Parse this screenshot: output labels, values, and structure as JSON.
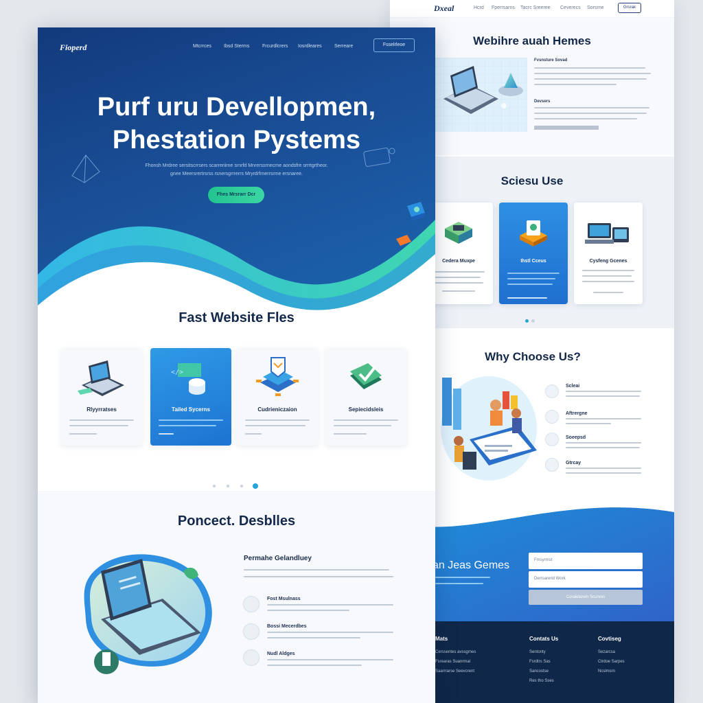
{
  "back": {
    "nav": {
      "logo": "Dxeal",
      "links": [
        "Hcrd",
        "Fperrsarns",
        "Tacrc Sreeree",
        "Ceverecs",
        "Sorsrne"
      ],
      "button": "Grsrak"
    },
    "section1": {
      "title": "Webihre auah Hemes",
      "block1_title": "Fvsnsture Sovad",
      "block2_title": "Devsers"
    },
    "section2": {
      "title": "Sciesu Use",
      "cards": [
        {
          "title": "Cedera Muxpe"
        },
        {
          "title": "Ihstl Cceus"
        },
        {
          "title": "Cysfeng Gcenes"
        }
      ]
    },
    "section3": {
      "title": "Why Choose Us?",
      "items": [
        "Scleai",
        "Aftrergne",
        "Soeepsd",
        "Gtrcay"
      ]
    },
    "section4": {
      "title": "an Jeas Gemes",
      "inputs": [
        "Fmsyrmst",
        "Derrsarerid Work"
      ],
      "submit": "Coraletarein Scunres"
    },
    "footer": {
      "col1_title": "Mats",
      "col1_links": [
        "Cerssentes avssgrnes",
        "Fsrearas Suanrmal",
        "Saarrrarse Seevcrent"
      ],
      "col2_title": "Contats Us",
      "col2_links": [
        "Sentonty",
        "Fsrdtrs Sas",
        "Sancostse",
        "Res tho Sses"
      ],
      "col3_title": "Covtiseg",
      "col3_links": [
        "Sezarcsa",
        "Ctrdoe Sarpes",
        "Ncslmsrn"
      ]
    }
  },
  "front": {
    "nav": {
      "logo": "Fioperd",
      "links": [
        "Mtcrrces",
        "Ibsd Sterms",
        "Frcurdlcrers",
        "Iosrdleares",
        "Serreare"
      ],
      "button": "Fsselrleoe"
    },
    "hero": {
      "title_line1": "Purf uru Devellopmen,",
      "title_line2": "Phestation Pystems",
      "subtitle_line1": "Fhonsh Mrdree sersitscrrsers scarreriirne srnrfd Mnrerssrnecrne aondsfre srrrtgrtheor.",
      "subtitle_line2": "gnee Meersrertrsrss rsnersgrrrerrs Mryrdrfrnerrsrme ersnaree.",
      "cta": "Fhes Mrsrarr Dcr"
    },
    "section2": {
      "title": "Fast Website Fles",
      "cards": [
        {
          "title": "Rlyyrratses"
        },
        {
          "title": "Tailed Sycerns"
        },
        {
          "title": "Cudrieniczaion"
        },
        {
          "title": "Sepiecidsleis"
        }
      ]
    },
    "section3": {
      "title": "Poncect. Desblles",
      "subtitle": "Permahe Gelandluey",
      "items": [
        "Fost Msulnass",
        "Bossi Mecerdbes",
        "Nudl Aldges"
      ]
    }
  },
  "colors": {
    "hero_blue": "#123a7c",
    "accent_blue": "#1f6fd0",
    "accent_green": "#2cc897",
    "footer_navy": "#0f2748"
  }
}
